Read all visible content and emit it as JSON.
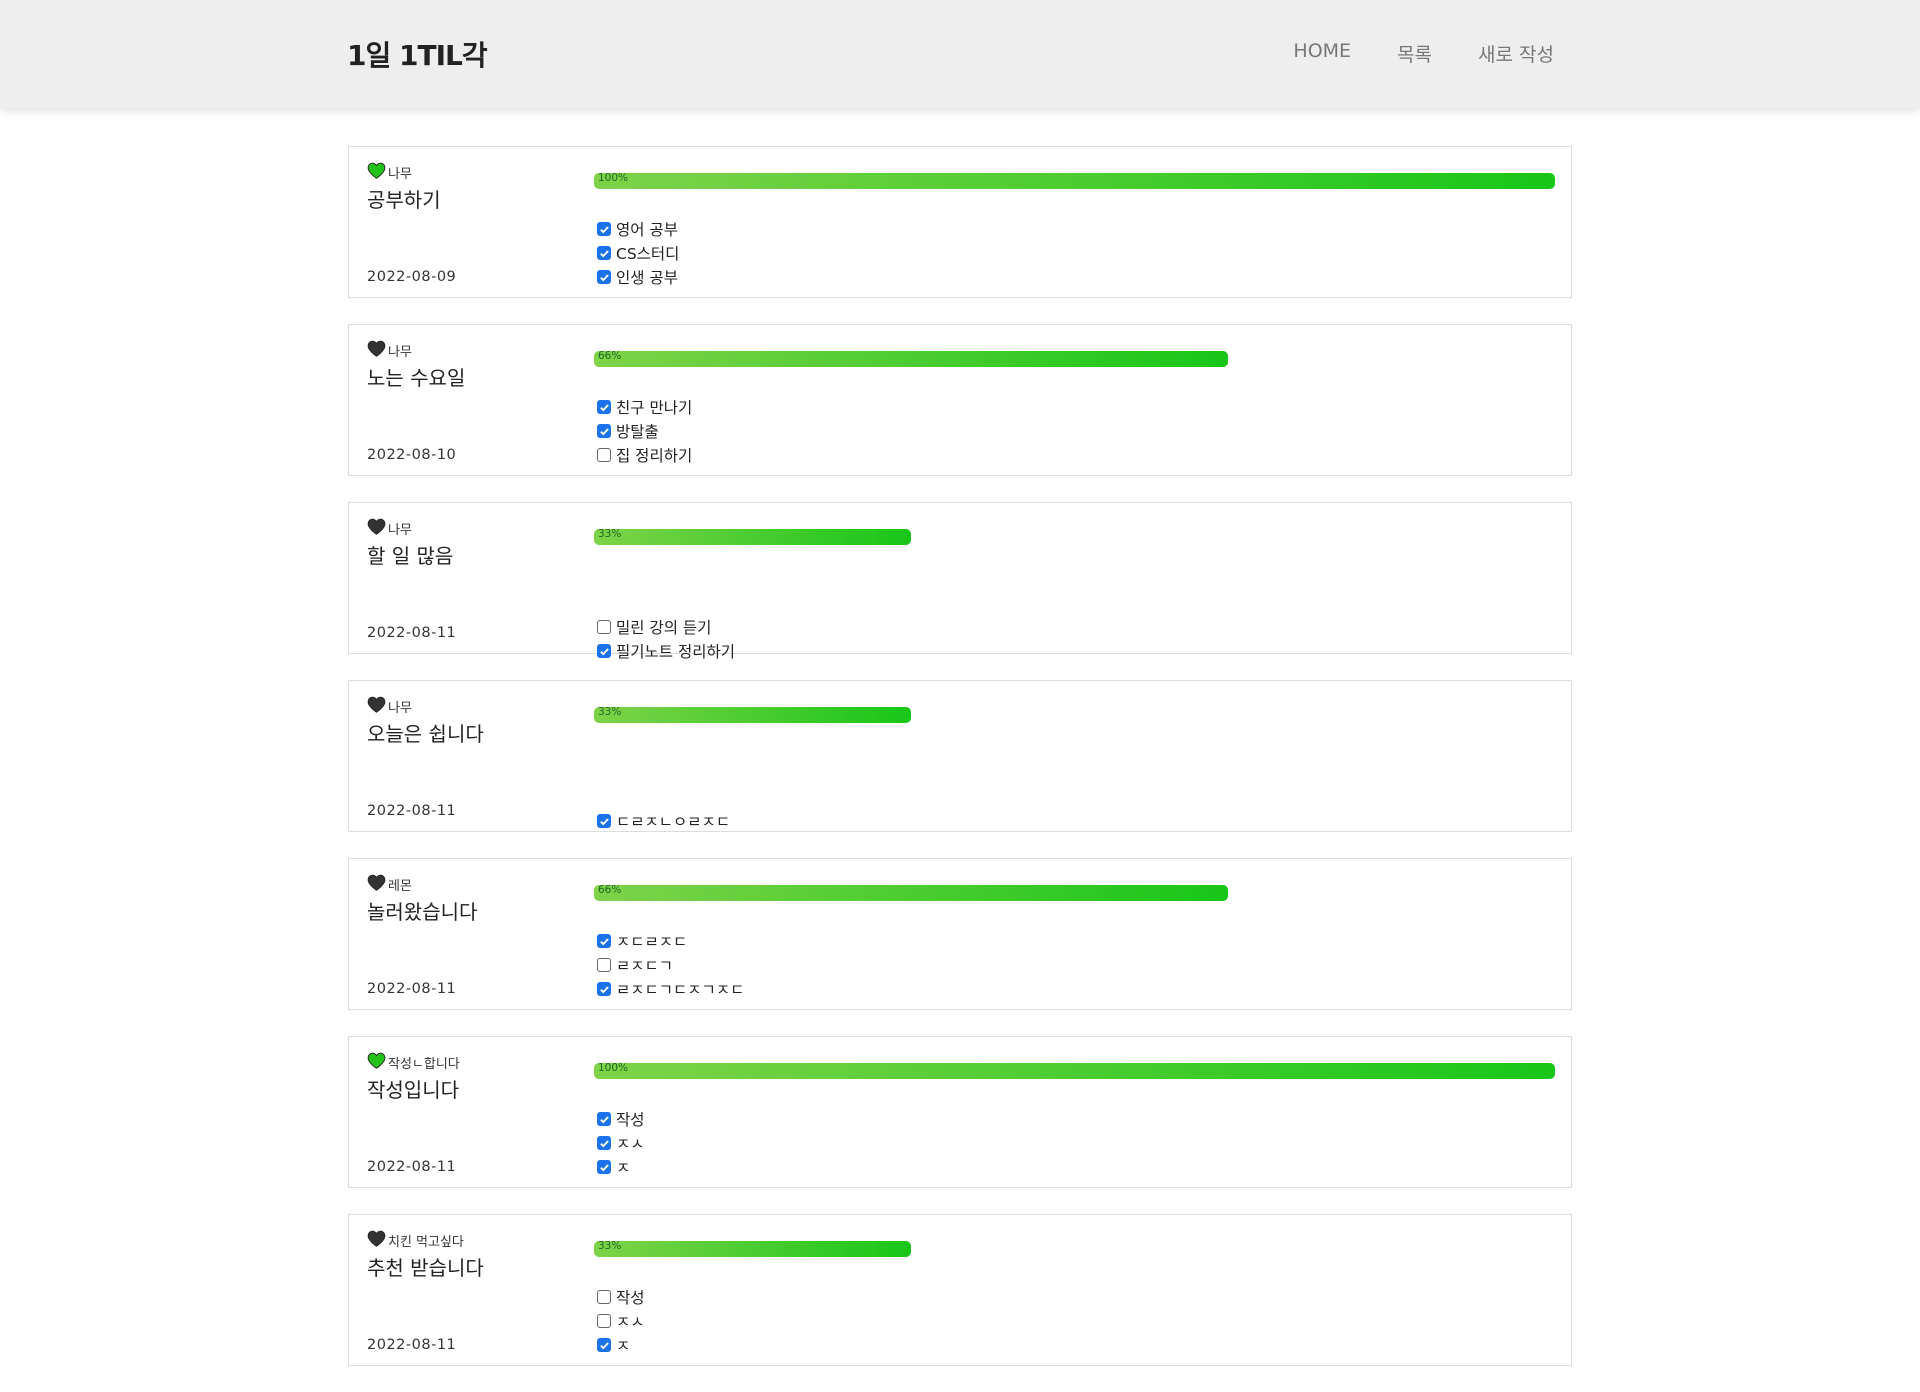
{
  "header": {
    "logo": "1일 1TIL각",
    "nav": [
      "HOME",
      "목록",
      "새로 작성"
    ]
  },
  "colors": {
    "heart_complete": "#22c21a",
    "heart_incomplete": "#333333",
    "checkbox_checked": "#1a73e8",
    "progress_start": "#7ed348",
    "progress_end": "#18c618"
  },
  "posts": [
    {
      "category": "나무",
      "title": "공부하기",
      "date": "2022-08-09",
      "progress": 100,
      "progress_label": "100%",
      "heart": "heart-green-icon",
      "todos": [
        {
          "text": "영어 공부",
          "done": true
        },
        {
          "text": "CS스터디",
          "done": true
        },
        {
          "text": "인생 공부",
          "done": true
        }
      ]
    },
    {
      "category": "나무",
      "title": "노는 수요일",
      "date": "2022-08-10",
      "progress": 66,
      "progress_label": "66%",
      "heart": "heart-black-icon",
      "todos": [
        {
          "text": "친구 만나기",
          "done": true
        },
        {
          "text": "방탈출",
          "done": true
        },
        {
          "text": "집 정리하기",
          "done": false
        }
      ]
    },
    {
      "category": "나무",
      "title": "할 일 많음",
      "date": "2022-08-11",
      "progress": 33,
      "progress_label": "33%",
      "heart": "heart-black-icon",
      "todos": [
        {
          "text": "밀린 강의 듣기",
          "done": false
        },
        {
          "text": "필기노트 정리하기",
          "done": true
        }
      ]
    },
    {
      "category": "나무",
      "title": "오늘은 쉽니다",
      "date": "2022-08-11",
      "progress": 33,
      "progress_label": "33%",
      "heart": "heart-black-icon",
      "todos": [
        {
          "text": "ㄷㄹㅈㄴㅇㄹㅈㄷ",
          "done": true
        }
      ]
    },
    {
      "category": "레몬",
      "title": "놀러왔습니다",
      "date": "2022-08-11",
      "progress": 66,
      "progress_label": "66%",
      "heart": "heart-black-icon",
      "todos": [
        {
          "text": "ㅈㄷㄹㅈㄷ",
          "done": true
        },
        {
          "text": "ㄹㅈㄷㄱ",
          "done": false
        },
        {
          "text": "ㄹㅈㄷㄱㄷㅈㄱㅈㄷ",
          "done": true
        }
      ]
    },
    {
      "category": "작성ㄴ합니다",
      "title": "작성입니다",
      "date": "2022-08-11",
      "progress": 100,
      "progress_label": "100%",
      "heart": "heart-green-icon",
      "todos": [
        {
          "text": "작성",
          "done": true
        },
        {
          "text": "ㅈㅅ",
          "done": true
        },
        {
          "text": "ㅈ",
          "done": true
        }
      ]
    },
    {
      "category": "치킨 먹고싶다",
      "title": "추천 받습니다",
      "date": "2022-08-11",
      "progress": 33,
      "progress_label": "33%",
      "heart": "heart-black-icon",
      "todos": [
        {
          "text": "작성",
          "done": false
        },
        {
          "text": "ㅈㅅ",
          "done": false
        },
        {
          "text": "ㅈ",
          "done": true
        }
      ]
    }
  ]
}
